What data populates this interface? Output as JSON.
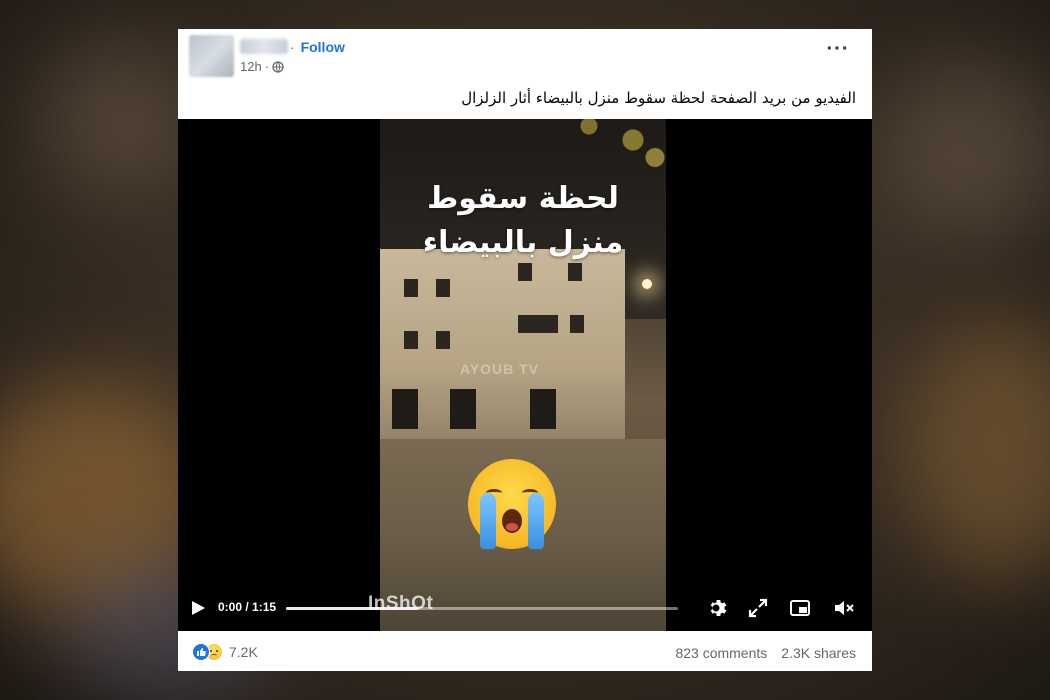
{
  "post": {
    "follow_label": "Follow",
    "separator": "·",
    "timestamp": "12h",
    "more_label": "···",
    "caption": "الفيديو من بريد الصفحة لحظة سقوط منزل بالبيضاء أثار الزلزال"
  },
  "video": {
    "overlay_line1": "لحظة سقوط",
    "overlay_line2": "منزل بالبيضاء",
    "watermark": "AYOUB TV",
    "inshot_watermark": "InShOt",
    "time_display": "0:00 / 1:15",
    "buffered_fraction": 0.34
  },
  "footer": {
    "reaction_count": "7.2K",
    "comments": "823 comments",
    "shares": "2.3K shares"
  },
  "colors": {
    "accent": "#1b74e4",
    "secondary_text": "#65676b"
  }
}
